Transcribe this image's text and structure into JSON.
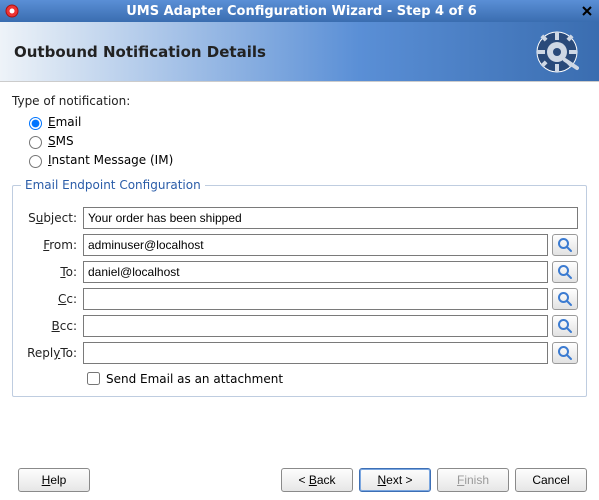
{
  "window": {
    "title": "UMS Adapter Configuration Wizard - Step 4 of 6"
  },
  "banner": {
    "title": "Outbound Notification Details"
  },
  "notification": {
    "section_label": "Type of notification:",
    "options": {
      "email_pre": "",
      "email_mn": "E",
      "email_post": "mail",
      "sms_pre": "",
      "sms_mn": "S",
      "sms_post": "MS",
      "im_pre": "",
      "im_mn": "I",
      "im_post": "nstant Message (IM)"
    }
  },
  "endpoint": {
    "legend": "Email Endpoint Configuration",
    "labels": {
      "subject_pre": "S",
      "subject_mn": "u",
      "subject_post": "bject:",
      "from_pre": "",
      "from_mn": "F",
      "from_post": "rom:",
      "to_pre": "",
      "to_mn": "T",
      "to_post": "o:",
      "cc_pre": "",
      "cc_mn": "C",
      "cc_post": "c:",
      "bcc_pre": "",
      "bcc_mn": "B",
      "bcc_post": "cc:",
      "reply_pre": "Repl",
      "reply_mn": "y",
      "reply_post": "To:"
    },
    "values": {
      "subject": "Your order has been shipped",
      "from": "adminuser@localhost",
      "to": "daniel@localhost",
      "cc": "",
      "bcc": "",
      "replyto": ""
    },
    "attachment_label": "Send Email as an attachment"
  },
  "buttons": {
    "help_pre": "",
    "help_mn": "H",
    "help_post": "elp",
    "back_pre": "< ",
    "back_mn": "B",
    "back_post": "ack",
    "next_pre": "",
    "next_mn": "N",
    "next_post": "ext >",
    "finish_pre": "",
    "finish_mn": "F",
    "finish_post": "inish",
    "cancel": "Cancel"
  }
}
